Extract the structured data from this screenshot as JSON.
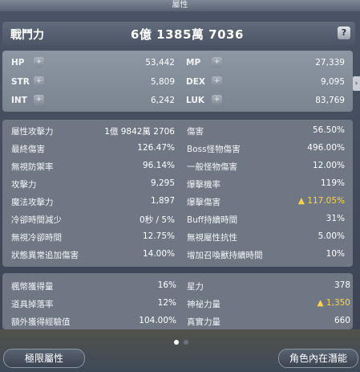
{
  "window": {
    "title": "屬性"
  },
  "combat_power": {
    "label": "戰鬥力",
    "value": "6億 1385萬 7036",
    "help": "?"
  },
  "base_stats": [
    {
      "label": "HP",
      "value": "53,442"
    },
    {
      "label": "MP",
      "value": "27,339"
    },
    {
      "label": "STR",
      "value": "5,809"
    },
    {
      "label": "DEX",
      "value": "9,095"
    },
    {
      "label": "INT",
      "value": "6,242"
    },
    {
      "label": "LUK",
      "value": "83,769"
    }
  ],
  "plus_glyph": "+",
  "detail_stats": [
    {
      "label": "屬性攻擊力",
      "value": "1億 9842萬 2706"
    },
    {
      "label": "傷害",
      "value": "56.50%"
    },
    {
      "label": "最終傷害",
      "value": "126.47%"
    },
    {
      "label": "Boss怪物傷害",
      "value": "496.00%"
    },
    {
      "label": "無視防禦率",
      "value": "96.14%"
    },
    {
      "label": "一般怪物傷害",
      "value": "12.00%"
    },
    {
      "label": "攻擊力",
      "value": "9,295"
    },
    {
      "label": "爆擊機率",
      "value": "119%"
    },
    {
      "label": "魔法攻擊力",
      "value": "1,897"
    },
    {
      "label": "爆擊傷害",
      "value": "▲ 117.05%"
    },
    {
      "label": "冷卻時間減少",
      "value": "0秒 / 5%"
    },
    {
      "label": "Buff持續時間",
      "value": "31%"
    },
    {
      "label": "無視冷卻時間",
      "value": "12.75%"
    },
    {
      "label": "無視屬性抗性",
      "value": "5.00%"
    },
    {
      "label": "狀態異常追加傷害",
      "value": "14.00%"
    },
    {
      "label": "增加召喚獸持續時間",
      "value": "10%"
    }
  ],
  "extra_stats": [
    {
      "label": "楓幣獲得量",
      "value": "16%"
    },
    {
      "label": "星力",
      "value": "378"
    },
    {
      "label": "道具掉落率",
      "value": "12%"
    },
    {
      "label": "神祕力量",
      "value": "▲ 1,350"
    },
    {
      "label": "額外獲得經驗值",
      "value": "104.00%"
    },
    {
      "label": "真實力量",
      "value": "660"
    }
  ],
  "colors": {
    "highlight": "#ffd24a"
  },
  "expand_arrow": "›",
  "pagination": {
    "current": 1,
    "total": 2
  },
  "buttons": {
    "left": "極限屬性",
    "right": "角色內在潛能"
  }
}
